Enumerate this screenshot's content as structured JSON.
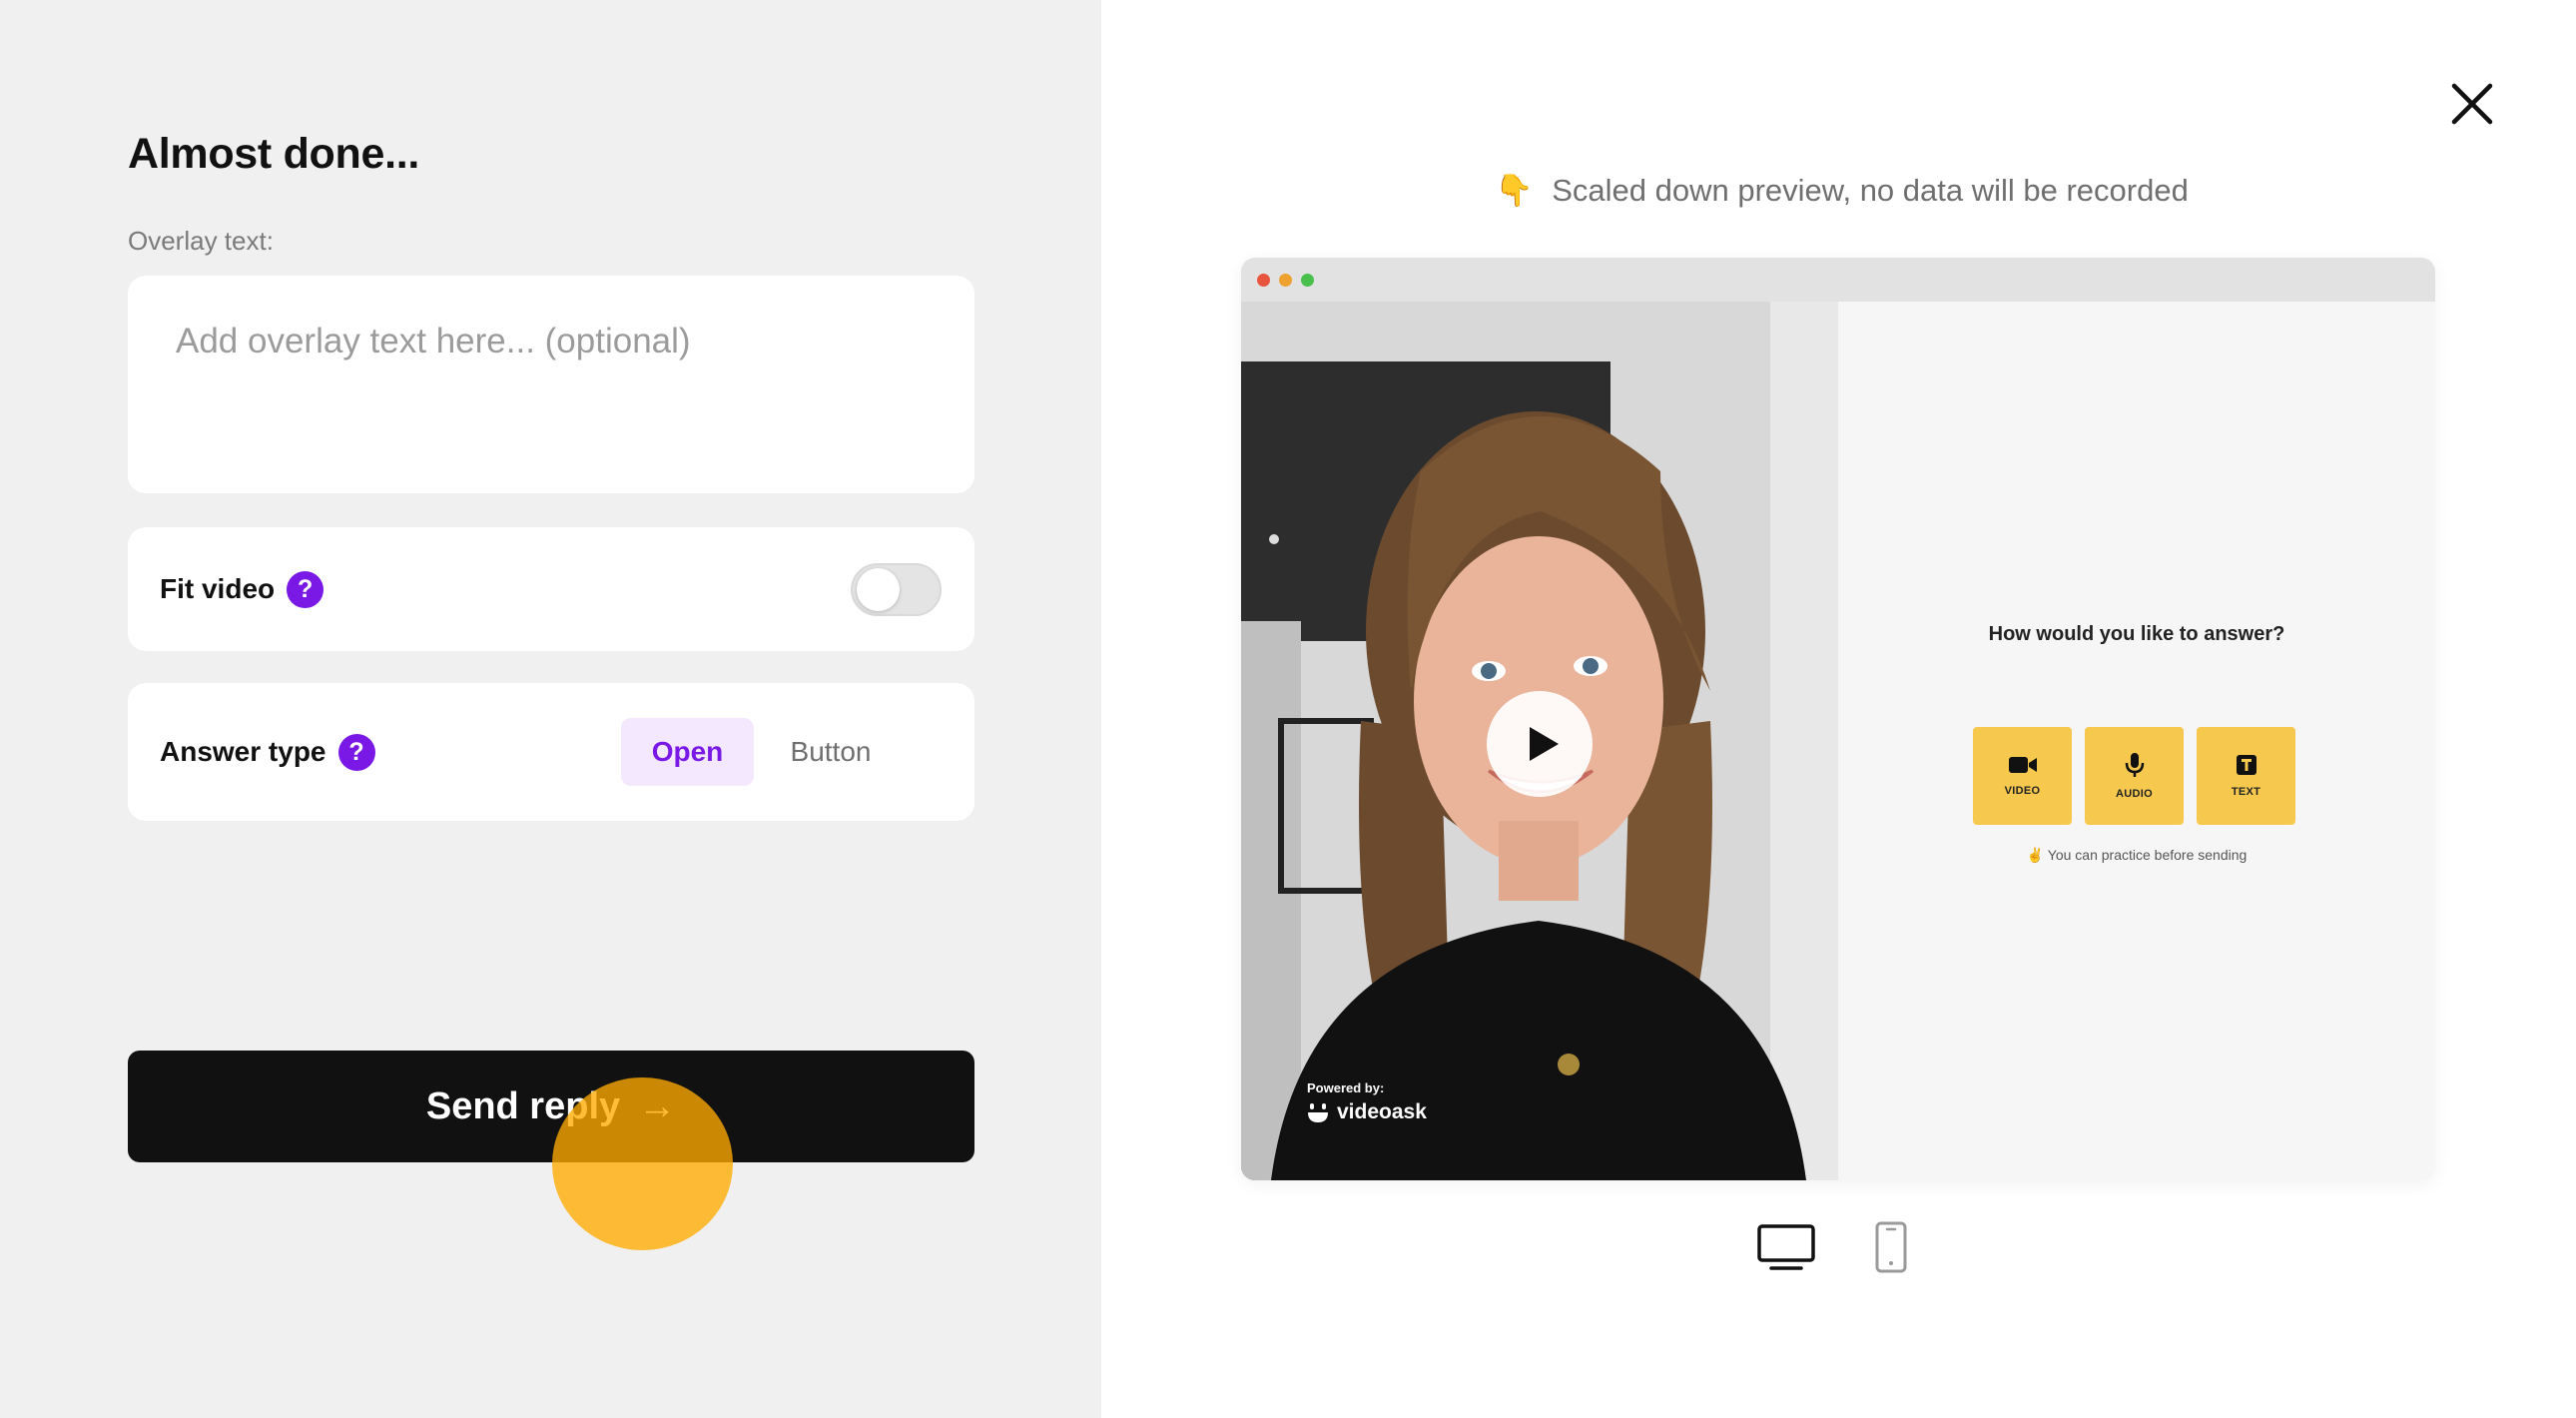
{
  "form": {
    "title": "Almost done...",
    "overlay_label": "Overlay text:",
    "overlay_placeholder": "Add overlay text here... (optional)",
    "fit_video": {
      "label": "Fit video",
      "help": "?",
      "enabled": false
    },
    "answer_type": {
      "label": "Answer type",
      "help": "?",
      "options": [
        "Open",
        "Button"
      ],
      "selected": "Open"
    },
    "send_label": "Send reply",
    "send_arrow": "→"
  },
  "preview": {
    "note_icon": "👇",
    "note": "Scaled down preview, no data will be recorded",
    "video": {
      "powered_by": "Powered by:",
      "brand": "videoask"
    },
    "question": "How would you like to answer?",
    "options": [
      {
        "label": "VIDEO",
        "icon": "camera-icon"
      },
      {
        "label": "AUDIO",
        "icon": "microphone-icon"
      },
      {
        "label": "TEXT",
        "icon": "text-icon"
      }
    ],
    "practice_note": "✌️ You can practice before sending"
  },
  "devices": [
    "desktop-icon",
    "mobile-icon"
  ],
  "colors": {
    "accent": "#7a19e6",
    "accent_light": "#f3e8fd",
    "answer_option": "#f6c94e",
    "send_button": "#111111",
    "cursor": "#ffaa00"
  }
}
